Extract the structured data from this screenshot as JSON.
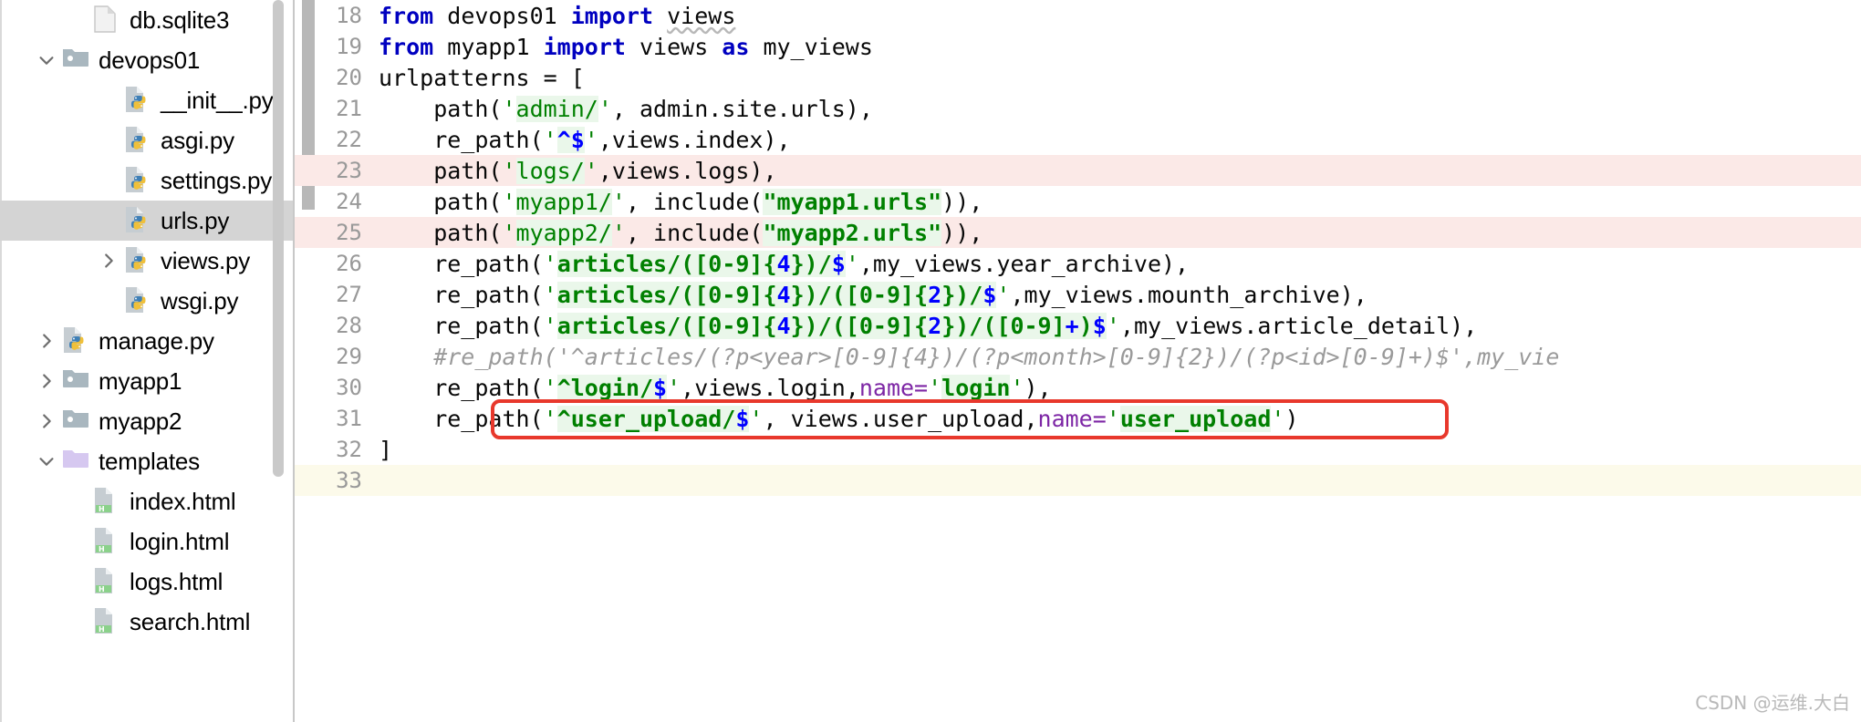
{
  "sidebar": {
    "scrollbar_label": "project-tree-scrollbar",
    "items": [
      {
        "label": "db.sqlite3",
        "icon": "file-icon",
        "indent": 2,
        "twisty": "none",
        "selected": false
      },
      {
        "label": "devops01",
        "icon": "folder-icon",
        "indent": 1,
        "twisty": "expanded",
        "selected": false
      },
      {
        "label": "__init__.py",
        "icon": "python-file-icon",
        "indent": 3,
        "twisty": "none",
        "selected": false
      },
      {
        "label": "asgi.py",
        "icon": "python-file-icon",
        "indent": 3,
        "twisty": "none",
        "selected": false
      },
      {
        "label": "settings.py",
        "icon": "python-file-icon",
        "indent": 3,
        "twisty": "none",
        "selected": false
      },
      {
        "label": "urls.py",
        "icon": "python-file-icon",
        "indent": 3,
        "twisty": "none",
        "selected": true
      },
      {
        "label": "views.py",
        "icon": "python-file-icon",
        "indent": 3,
        "twisty": "collapsed",
        "selected": false
      },
      {
        "label": "wsgi.py",
        "icon": "python-file-icon",
        "indent": 3,
        "twisty": "none",
        "selected": false
      },
      {
        "label": "manage.py",
        "icon": "python-file-icon",
        "indent": 1,
        "twisty": "collapsed",
        "selected": false
      },
      {
        "label": "myapp1",
        "icon": "folder-icon",
        "indent": 1,
        "twisty": "collapsed",
        "selected": false
      },
      {
        "label": "myapp2",
        "icon": "folder-icon",
        "indent": 1,
        "twisty": "collapsed",
        "selected": false
      },
      {
        "label": "templates",
        "icon": "folder-purple-icon",
        "indent": 1,
        "twisty": "expanded",
        "selected": false
      },
      {
        "label": "index.html",
        "icon": "html-file-icon",
        "indent": 2,
        "twisty": "none",
        "selected": false
      },
      {
        "label": "login.html",
        "icon": "html-file-icon",
        "indent": 2,
        "twisty": "none",
        "selected": false
      },
      {
        "label": "logs.html",
        "icon": "html-file-icon",
        "indent": 2,
        "twisty": "none",
        "selected": false
      },
      {
        "label": "search.html",
        "icon": "html-file-icon",
        "indent": 2,
        "twisty": "none",
        "selected": false
      }
    ]
  },
  "editor": {
    "first_visible_line": 18,
    "lines": [
      {
        "no": "18",
        "state": "normal",
        "tokens": [
          {
            "t": "from ",
            "c": "kw"
          },
          {
            "t": "devops01 ",
            "c": "plain"
          },
          {
            "t": "import",
            "c": "kw"
          },
          {
            "t": " ",
            "c": "plain"
          },
          {
            "t": "views",
            "c": "err"
          }
        ]
      },
      {
        "no": "19",
        "state": "normal",
        "tokens": [
          {
            "t": "from ",
            "c": "kw"
          },
          {
            "t": "myapp1 ",
            "c": "plain"
          },
          {
            "t": "import",
            "c": "kw"
          },
          {
            "t": " views ",
            "c": "plain"
          },
          {
            "t": "as",
            "c": "kw"
          },
          {
            "t": " my_views",
            "c": "plain"
          }
        ]
      },
      {
        "no": "20",
        "state": "normal",
        "tokens": [
          {
            "t": "urlpatterns = [",
            "c": "plain"
          }
        ]
      },
      {
        "no": "21",
        "state": "normal",
        "tokens": [
          {
            "t": "    path(",
            "c": "plain"
          },
          {
            "t": "'",
            "c": "strq"
          },
          {
            "t": "admin/",
            "c": "str"
          },
          {
            "t": "'",
            "c": "strq"
          },
          {
            "t": ", admin.site.urls),",
            "c": "plain"
          }
        ]
      },
      {
        "no": "22",
        "state": "normal",
        "tokens": [
          {
            "t": "    re_path(",
            "c": "plain"
          },
          {
            "t": "'",
            "c": "strq"
          },
          {
            "t": "^$",
            "c": "regn"
          },
          {
            "t": "'",
            "c": "strq"
          },
          {
            "t": ",views.index),",
            "c": "plain"
          }
        ]
      },
      {
        "no": "23",
        "state": "modified",
        "tokens": [
          {
            "t": "    path(",
            "c": "plain"
          },
          {
            "t": "'",
            "c": "strq"
          },
          {
            "t": "logs/",
            "c": "str"
          },
          {
            "t": "'",
            "c": "strq"
          },
          {
            "t": ",views.logs),",
            "c": "plain"
          }
        ]
      },
      {
        "no": "24",
        "state": "normal",
        "tokens": [
          {
            "t": "    path(",
            "c": "plain"
          },
          {
            "t": "'",
            "c": "strq"
          },
          {
            "t": "myapp1/",
            "c": "str"
          },
          {
            "t": "'",
            "c": "strq"
          },
          {
            "t": ", include(",
            "c": "plain"
          },
          {
            "t": "\"myapp1.urls\"",
            "c": "reg"
          },
          {
            "t": ")),",
            "c": "plain"
          }
        ]
      },
      {
        "no": "25",
        "state": "modified",
        "tokens": [
          {
            "t": "    path(",
            "c": "plain"
          },
          {
            "t": "'",
            "c": "strq"
          },
          {
            "t": "myapp2/",
            "c": "str"
          },
          {
            "t": "'",
            "c": "strq"
          },
          {
            "t": ", include(",
            "c": "plain"
          },
          {
            "t": "\"myapp2.urls\"",
            "c": "reg"
          },
          {
            "t": ")),",
            "c": "plain"
          }
        ]
      },
      {
        "no": "26",
        "state": "normal",
        "tokens": [
          {
            "t": "    re_path(",
            "c": "plain"
          },
          {
            "t": "'",
            "c": "strq"
          },
          {
            "t": "articles/([",
            "c": "reg"
          },
          {
            "t": "0-9",
            "c": "reg"
          },
          {
            "t": "]{",
            "c": "reg"
          },
          {
            "t": "4",
            "c": "regn"
          },
          {
            "t": "})/",
            "c": "reg"
          },
          {
            "t": "$",
            "c": "regn"
          },
          {
            "t": "'",
            "c": "strq"
          },
          {
            "t": ",my_views.year_archive),",
            "c": "plain"
          }
        ]
      },
      {
        "no": "27",
        "state": "normal",
        "tokens": [
          {
            "t": "    re_path(",
            "c": "plain"
          },
          {
            "t": "'",
            "c": "strq"
          },
          {
            "t": "articles/([",
            "c": "reg"
          },
          {
            "t": "0-9",
            "c": "reg"
          },
          {
            "t": "]{",
            "c": "reg"
          },
          {
            "t": "4",
            "c": "regn"
          },
          {
            "t": "})/([",
            "c": "reg"
          },
          {
            "t": "0-9",
            "c": "reg"
          },
          {
            "t": "]{",
            "c": "reg"
          },
          {
            "t": "2",
            "c": "regn"
          },
          {
            "t": "})/",
            "c": "reg"
          },
          {
            "t": "$",
            "c": "regn"
          },
          {
            "t": "'",
            "c": "strq"
          },
          {
            "t": ",my_views.mounth_archive),",
            "c": "plain"
          }
        ]
      },
      {
        "no": "28",
        "state": "normal",
        "tokens": [
          {
            "t": "    re_path(",
            "c": "plain"
          },
          {
            "t": "'",
            "c": "strq"
          },
          {
            "t": "articles/([",
            "c": "reg"
          },
          {
            "t": "0-9",
            "c": "reg"
          },
          {
            "t": "]{",
            "c": "reg"
          },
          {
            "t": "4",
            "c": "regn"
          },
          {
            "t": "})/([",
            "c": "reg"
          },
          {
            "t": "0-9",
            "c": "reg"
          },
          {
            "t": "]{",
            "c": "reg"
          },
          {
            "t": "2",
            "c": "regn"
          },
          {
            "t": "})/([",
            "c": "reg"
          },
          {
            "t": "0-9",
            "c": "reg"
          },
          {
            "t": "]",
            "c": "reg"
          },
          {
            "t": "+",
            "c": "regn"
          },
          {
            "t": ")",
            "c": "reg"
          },
          {
            "t": "$",
            "c": "regn"
          },
          {
            "t": "'",
            "c": "strq"
          },
          {
            "t": ",my_views.article_detail),",
            "c": "plain"
          }
        ]
      },
      {
        "no": "29",
        "state": "normal",
        "tokens": [
          {
            "t": "    #re_path('^articles/(?p<year>[0-9]{4})/(?p<month>[0-9]{2})/(?p<id>[0-9]+)$',my_vie",
            "c": "cmt"
          }
        ]
      },
      {
        "no": "30",
        "state": "normal",
        "tokens": [
          {
            "t": "    re_path(",
            "c": "plain"
          },
          {
            "t": "'",
            "c": "strq"
          },
          {
            "t": "^login/",
            "c": "reg"
          },
          {
            "t": "$",
            "c": "regn"
          },
          {
            "t": "'",
            "c": "strq"
          },
          {
            "t": ",views.login,",
            "c": "plain"
          },
          {
            "t": "name=",
            "c": "kwarg"
          },
          {
            "t": "'",
            "c": "strq"
          },
          {
            "t": "login",
            "c": "reg"
          },
          {
            "t": "'",
            "c": "strq"
          },
          {
            "t": "),",
            "c": "plain"
          }
        ]
      },
      {
        "no": "31",
        "state": "normal",
        "tokens": [
          {
            "t": "    re_path(",
            "c": "plain"
          },
          {
            "t": "'",
            "c": "strq"
          },
          {
            "t": "^user_upload/",
            "c": "reg"
          },
          {
            "t": "$",
            "c": "regn"
          },
          {
            "t": "'",
            "c": "strq"
          },
          {
            "t": ", views.user_upload,",
            "c": "plain"
          },
          {
            "t": "name=",
            "c": "kwarg"
          },
          {
            "t": "'",
            "c": "strq"
          },
          {
            "t": "user_upload",
            "c": "reg"
          },
          {
            "t": "'",
            "c": "strq"
          },
          {
            "t": ")",
            "c": "plain"
          }
        ]
      },
      {
        "no": "32",
        "state": "normal",
        "tokens": [
          {
            "t": "]",
            "c": "plain"
          }
        ]
      },
      {
        "no": "33",
        "state": "cursor",
        "tokens": [
          {
            "t": "",
            "c": "plain"
          }
        ]
      }
    ],
    "annotation": {
      "name": "red-highlight-box",
      "color": "#e8382c"
    }
  },
  "watermark": {
    "text": "CSDN @运维.大白"
  }
}
